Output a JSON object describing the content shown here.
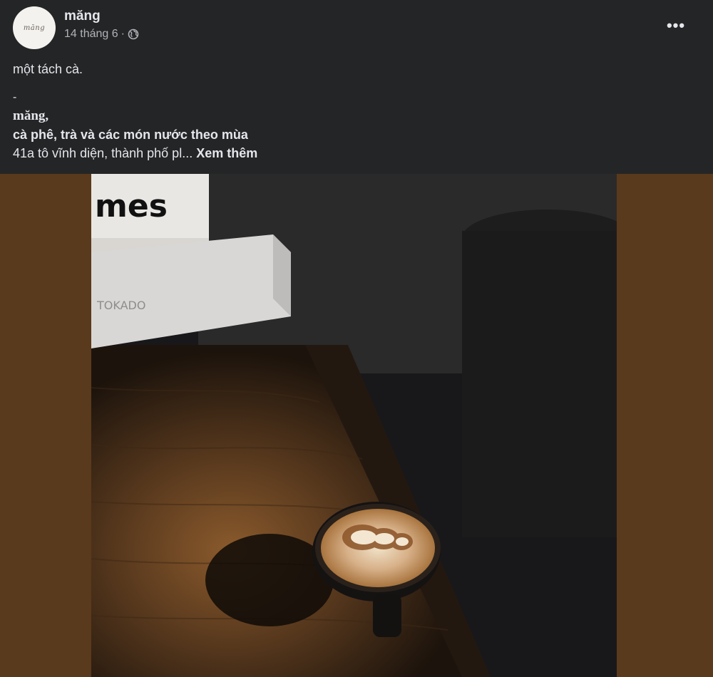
{
  "post": {
    "author": "măng",
    "avatar_logo_text": "măng",
    "date": "14 tháng 6",
    "separator": "·",
    "privacy_icon": "globe-icon",
    "more_icon": "more-horizontal-icon",
    "more_label": "•••",
    "text": {
      "line1": "một tách cà.",
      "dash": "-",
      "brand": "măng,",
      "tagline": "cà phê, trà và các món nước theo mùa",
      "address": "41a tô vĩnh diện, thành phố pl...",
      "see_more": "Xem thêm"
    }
  },
  "photo": {
    "sign_text": "mes",
    "box_text": "TOKADO",
    "description_icon": "coffee-latte-photo"
  },
  "colors": {
    "background": "#242526",
    "text_primary": "#e4e6eb",
    "text_secondary": "#b0b3b8",
    "photo_border": "#5a3a1c"
  }
}
